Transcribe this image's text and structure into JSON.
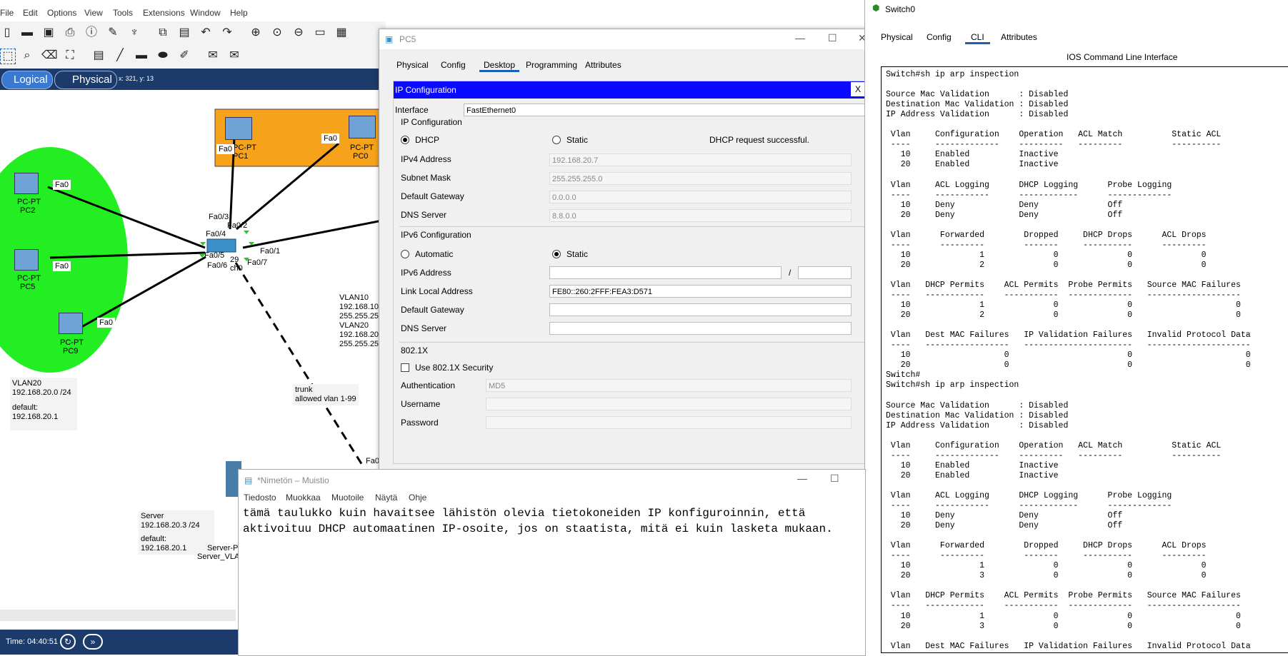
{
  "menu": [
    "File",
    "Edit",
    "Options",
    "View",
    "Tools",
    "Extensions",
    "Window",
    "Help"
  ],
  "modes": {
    "logical": "Logical",
    "physical": "Physical",
    "coords": "x: 321, y: 13"
  },
  "topology": {
    "devices": [
      {
        "type": "PC-PT",
        "name": "PC1"
      },
      {
        "type": "PC-PT",
        "name": "PC0"
      },
      {
        "type": "PC-PT",
        "name": "PC2"
      },
      {
        "type": "PC-PT",
        "name": "PC5"
      },
      {
        "type": "PC-PT",
        "name": "PC9"
      }
    ],
    "ports": [
      "Fa0",
      "Fa0",
      "Fa0",
      "Fa0",
      "Fa0",
      "Fa0/3",
      "Fa0/2",
      "Fa0/4",
      "Fa0/1",
      "Fa0/5",
      "Fa0/6",
      "Fa0/7",
      "Fa0"
    ],
    "switch_labels": [
      "29",
      "ch0"
    ],
    "vlan_note": [
      "VLAN10",
      "192.168.10",
      "255.255.25",
      "VLAN20",
      "192.168.20",
      "255.255.25"
    ],
    "vlan20_note": [
      "VLAN20",
      "192.168.20.0 /24",
      "",
      "default:",
      "192.168.20.1"
    ],
    "trunk_note": [
      "trunk",
      "allowed vlan 1-99"
    ],
    "server_note": [
      "Server",
      "192.168.20.3 /24",
      "",
      "default: 192.168.20.1"
    ],
    "server_labels": [
      "Server-P",
      "Server_VLA"
    ]
  },
  "status": {
    "time": "Time: 04:40:51"
  },
  "pc5": {
    "title": "PC5",
    "tabs": [
      "Physical",
      "Config",
      "Desktop",
      "Programming",
      "Attributes"
    ],
    "active_tab": "Desktop",
    "ipconfig_title": "IP Configuration",
    "close": "X",
    "interface_label": "Interface",
    "interface_value": "FastEthernet0",
    "ipv4_section": "IP Configuration",
    "dhcp": "DHCP",
    "static": "Static",
    "dhcp_status": "DHCP request successful.",
    "ipv4_address_label": "IPv4 Address",
    "ipv4_address": "192.168.20.7",
    "subnet_label": "Subnet Mask",
    "subnet": "255.255.255.0",
    "gateway_label": "Default Gateway",
    "gateway": "0.0.0.0",
    "dns_label": "DNS Server",
    "dns": "8.8.0.0",
    "ipv6_section": "IPv6 Configuration",
    "automatic": "Automatic",
    "static6": "Static",
    "ipv6_address_label": "IPv6 Address",
    "ipv6_address": "",
    "ipv6_prefix": "",
    "slash": "/",
    "link_local_label": "Link Local Address",
    "link_local": "FE80::260:2FFF:FEA3:D571",
    "gateway6_label": "Default Gateway",
    "gateway6": "",
    "dns6_label": "DNS Server",
    "dns6": "",
    "dot1x_section": "802.1X",
    "use_dot1x": "Use 802.1X Security",
    "auth_label": "Authentication",
    "auth_value": "MD5",
    "username_label": "Username",
    "username": "",
    "password_label": "Password",
    "password": ""
  },
  "switch": {
    "title": "Switch0",
    "tabs": [
      "Physical",
      "Config",
      "CLI",
      "Attributes"
    ],
    "active_tab": "CLI",
    "cli_title": "IOS Command Line Interface",
    "cli_output": "Switch#sh ip arp inspection\n\nSource Mac Validation      : Disabled\nDestination Mac Validation : Disabled\nIP Address Validation      : Disabled\n\n Vlan     Configuration    Operation   ACL Match          Static ACL\n ----     -------------    ---------   ---------          ----------\n   10     Enabled          Inactive\n   20     Enabled          Inactive\n\n Vlan     ACL Logging      DHCP Logging      Probe Logging\n ----     -----------      ------------      -------------\n   10     Deny             Deny              Off\n   20     Deny             Deny              Off\n\n Vlan      Forwarded        Dropped     DHCP Drops      ACL Drops\n ----      ---------        -------     ----------      ---------\n   10              1              0              0              0\n   20              2              0              0              0\n\n Vlan   DHCP Permits    ACL Permits  Probe Permits   Source MAC Failures\n ----   ------------    -----------  -------------   -------------------\n   10              1              0              0                     0\n   20              2              0              0                     0\n\n Vlan   Dest MAC Failures   IP Validation Failures   Invalid Protocol Data\n ----   -----------------   ----------------------   ---------------------\n   10                   0                        0                       0\n   20                   0                        0                       0\nSwitch#\nSwitch#sh ip arp inspection\n\nSource Mac Validation      : Disabled\nDestination Mac Validation : Disabled\nIP Address Validation      : Disabled\n\n Vlan     Configuration    Operation   ACL Match          Static ACL\n ----     -------------    ---------   ---------          ----------\n   10     Enabled          Inactive\n   20     Enabled          Inactive\n\n Vlan     ACL Logging      DHCP Logging      Probe Logging\n ----     -----------      ------------      -------------\n   10     Deny             Deny              Off\n   20     Deny             Deny              Off\n\n Vlan      Forwarded        Dropped     DHCP Drops      ACL Drops\n ----      ---------        -------     ----------      ---------\n   10              1              0              0              0\n   20              3              0              0              0\n\n Vlan   DHCP Permits    ACL Permits  Probe Permits   Source MAC Failures\n ----   ------------    -----------  -------------   -------------------\n   10              1              0              0                     0\n   20              3              0              0                     0\n\n Vlan   Dest MAC Failures   IP Validation Failures   Invalid Protocol Data"
  },
  "notepad": {
    "title": "*Nimetön – Muistio",
    "menu": [
      "Tiedosto",
      "Muokkaa",
      "Muotoile",
      "Näytä",
      "Ohje"
    ],
    "text": "tämä taulukko kuin havaitsee lähistön olevia tietokoneiden IP konfiguroinnin, että\naktivoituu DHCP automaatinen IP-osoite, jos on staatista, mitä ei kuin lasketa mukaan."
  },
  "colors": {
    "green_zone": "#22ee22",
    "orange_zone": "#f7a21b",
    "ip_title_bar": "#0a0aff",
    "status_bar": "#1c3b6b"
  }
}
